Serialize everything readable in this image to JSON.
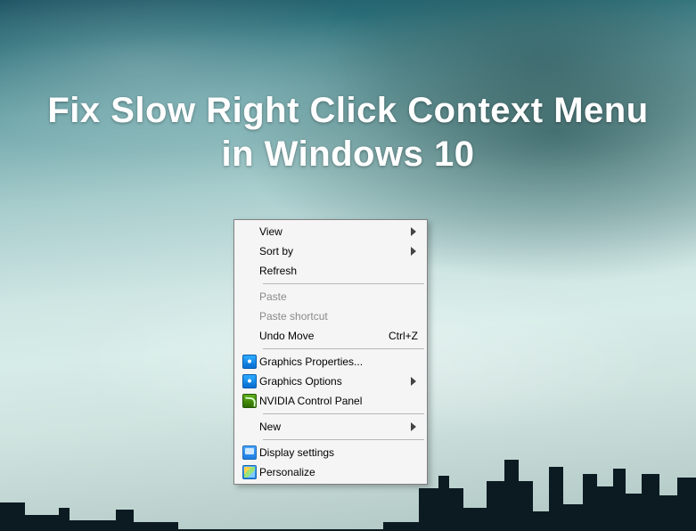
{
  "title": "Fix Slow Right Click Context Menu in Windows 10",
  "menu": {
    "view": {
      "label": "View",
      "submenu": true
    },
    "sortby": {
      "label": "Sort by",
      "submenu": true
    },
    "refresh": {
      "label": "Refresh"
    },
    "paste": {
      "label": "Paste",
      "disabled": true
    },
    "pastesc": {
      "label": "Paste shortcut",
      "disabled": true
    },
    "undomove": {
      "label": "Undo Move",
      "accel": "Ctrl+Z"
    },
    "gfxprops": {
      "label": "Graphics Properties..."
    },
    "gfxopts": {
      "label": "Graphics Options",
      "submenu": true
    },
    "nvidia": {
      "label": "NVIDIA Control Panel"
    },
    "new": {
      "label": "New",
      "submenu": true
    },
    "display": {
      "label": "Display settings"
    },
    "personalize": {
      "label": "Personalize"
    }
  }
}
